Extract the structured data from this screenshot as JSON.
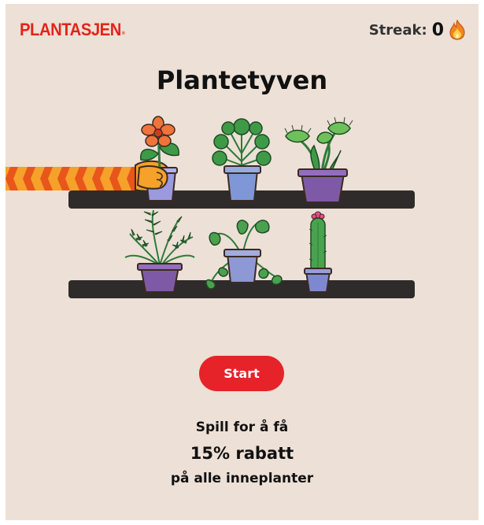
{
  "brand": {
    "logo_text": "PLANTASJEN",
    "logo_mark": "®",
    "color": "#e1251b"
  },
  "streak": {
    "label": "Streak:",
    "value": "0",
    "icon": "fire-icon"
  },
  "game": {
    "title": "Plantetyven"
  },
  "shelves": [
    {
      "plants": [
        "flower-plant",
        "pilea-plant",
        "venus-flytrap-plant"
      ]
    },
    {
      "plants": [
        "fern-plant",
        "pothos-plant",
        "cactus-plant"
      ]
    }
  ],
  "start_button": {
    "label": "Start",
    "color": "#e52329"
  },
  "promo": {
    "line1": "Spill for å få",
    "line2": "15% rabatt",
    "line3": "på alle inneplanter"
  },
  "colors": {
    "background": "#ede0d6",
    "shelf": "#2f2b2a"
  }
}
